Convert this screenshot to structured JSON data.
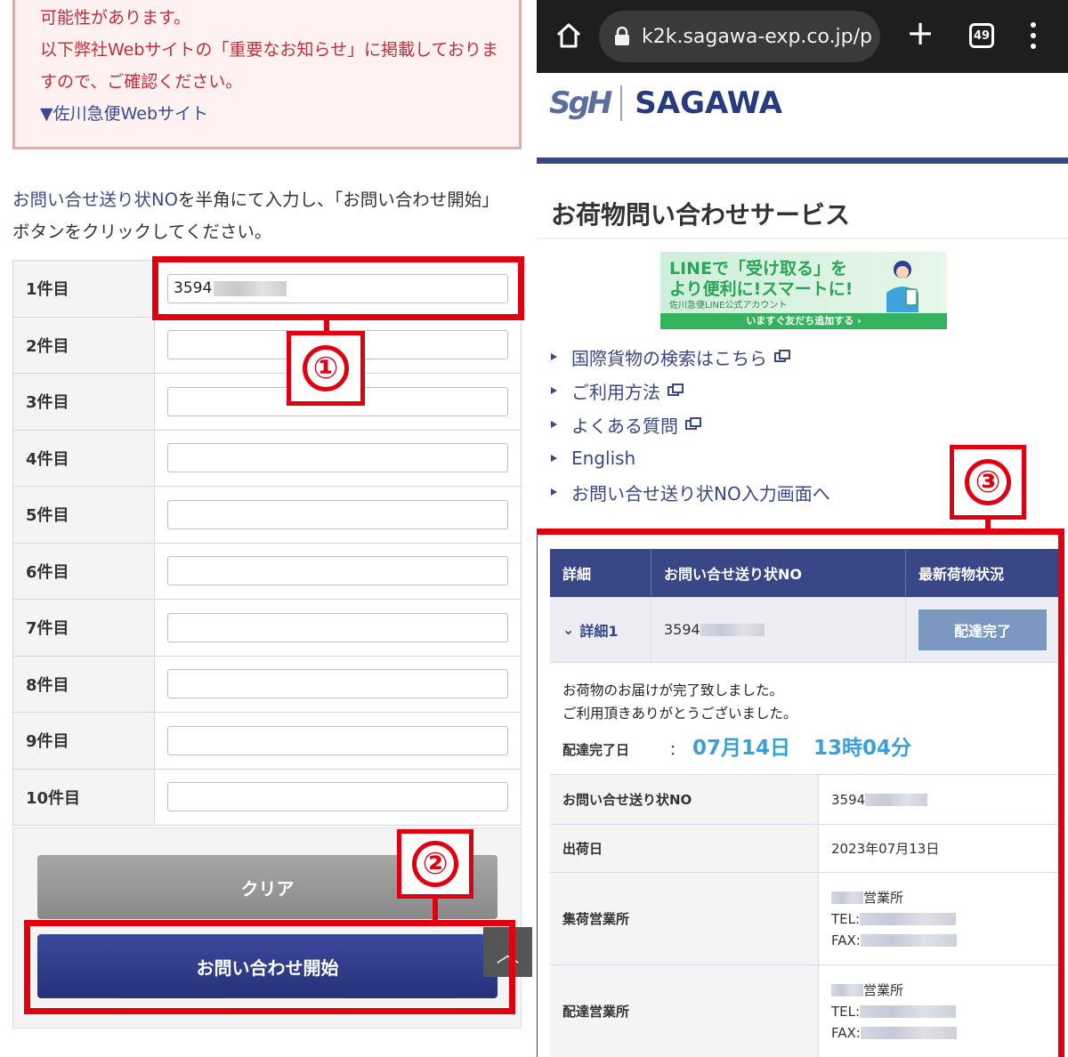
{
  "left": {
    "notice_lines": [
      "可能性があります。",
      "以下弊社Webサイトの「重要なお知らせ」に掲載しておりま",
      "すので、ご確認ください。"
    ],
    "notice_link": "▼佐川急便Webサイト",
    "instruction_highlight": "お問い合せ送り状NO",
    "instruction_line1_rest": "を半角にて入力し、「お問い合わせ開始」",
    "instruction_line2": "ボタンをクリックしてください。",
    "rows": [
      {
        "label": "1件目",
        "value": "3594"
      },
      {
        "label": "2件目",
        "value": ""
      },
      {
        "label": "3件目",
        "value": ""
      },
      {
        "label": "4件目",
        "value": ""
      },
      {
        "label": "5件目",
        "value": ""
      },
      {
        "label": "6件目",
        "value": ""
      },
      {
        "label": "7件目",
        "value": ""
      },
      {
        "label": "8件目",
        "value": ""
      },
      {
        "label": "9件目",
        "value": ""
      },
      {
        "label": "10件目",
        "value": ""
      }
    ],
    "clear_button": "クリア",
    "submit_button": "お問い合わせ開始",
    "scroll_top_glyph": "︿"
  },
  "callouts": {
    "one": "①",
    "two": "②",
    "three": "③"
  },
  "annotation_color": "#e00010",
  "right": {
    "browser": {
      "url": "k2k.sagawa-exp.co.jp/p.",
      "tab_count": "49"
    },
    "logo": {
      "mark": "SgH",
      "name": "SAGAWA"
    },
    "service_title": "お荷物問い合わせサービス",
    "banner": {
      "line1": "LINEで「受け取る」を",
      "line2": "より便利に!スマートに!",
      "line3": "佐川急便LINE公式アカウント",
      "cta": "いますぐ友だち追加する ›"
    },
    "links": [
      {
        "label": "国際貨物の検索はこちら",
        "external": true
      },
      {
        "label": "ご利用方法",
        "external": true
      },
      {
        "label": "よくある質問",
        "external": true
      },
      {
        "label": "English",
        "external": false
      },
      {
        "label": "お問い合せ送り状NO入力画面へ",
        "external": false
      }
    ],
    "result": {
      "headers": [
        "詳細",
        "お問い合せ送り状NO",
        "最新荷物状況"
      ],
      "detail_link": "詳細1",
      "tracking_no": "3594",
      "status": "配達完了",
      "msg_line1": "お荷物のお届けが完了致しました。",
      "msg_line2": "ご利用頂きありがとうございました。",
      "delivered_label": "配達完了日",
      "colon": "：",
      "delivered_date": "07月14日",
      "delivered_time": "13時04分",
      "info": {
        "tracking_label": "お問い合せ送り状NO",
        "tracking_value": "3594",
        "ship_label": "出荷日",
        "ship_value": "2023年07月13日",
        "pickup_label": "集荷営業所",
        "pickup_office": "営業所",
        "delivery_label": "配達営業所",
        "delivery_office": "営業所",
        "tel_label": "TEL:",
        "fax_label": "FAX:"
      }
    }
  }
}
